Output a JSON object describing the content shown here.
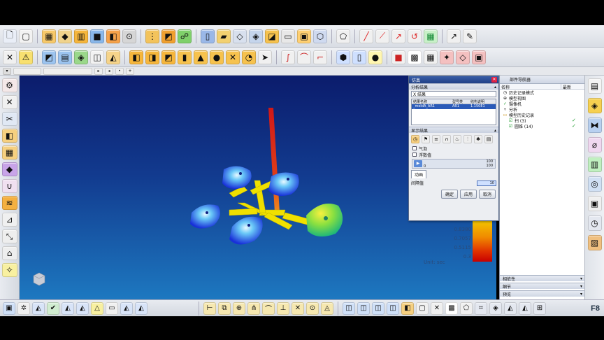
{
  "dialog": {
    "title": "仿真",
    "section_results": "分析结果",
    "filter_value": "X 结果",
    "grid": {
      "headers": [
        "结果名称",
        "型号类",
        "结构说明"
      ],
      "row": [
        "_moldA_AR1",
        "AR1",
        "1.150E1"
      ]
    },
    "section_display": "显示结果",
    "checkbox_1": "气泡",
    "checkbox_2": "浮数值",
    "slider_max": "100",
    "slider_min": "0",
    "slider_right": "100",
    "tab_animation": "动画",
    "rate_label": "间隔值",
    "rate_value": "10",
    "ok": "确定",
    "apply": "应用",
    "cancel": "取消"
  },
  "legend": {
    "values": [
      "0.8380",
      "0.7057",
      "0.5115",
      "0.3"
    ],
    "unit": "Unit: sec"
  },
  "navigator": {
    "title": "部件导航器",
    "col_name": "名称",
    "col_latest": "最新",
    "items": [
      {
        "label": "历史记录模式",
        "icon": "history-icon"
      },
      {
        "label": "模型视图",
        "icon": "view-icon"
      },
      {
        "label": "摄像机",
        "icon": "camera-icon"
      },
      {
        "label": "分析",
        "icon": "analysis-icon"
      },
      {
        "label": "模型历史记录",
        "icon": "folder-icon"
      },
      {
        "label": "扫 (3)",
        "icon": "sweep-icon"
      },
      {
        "label": "圆锥 (14)",
        "icon": "cone-icon"
      }
    ],
    "footer_1": "细节",
    "footer_2": "预览",
    "footer_3": "相依性"
  },
  "status": {
    "f8": "F8"
  },
  "colors": {
    "viewport_top": "#0b1c6c",
    "viewport_bottom": "#1d78c0",
    "sprue": "#d83020",
    "runner": "#f0e000"
  }
}
